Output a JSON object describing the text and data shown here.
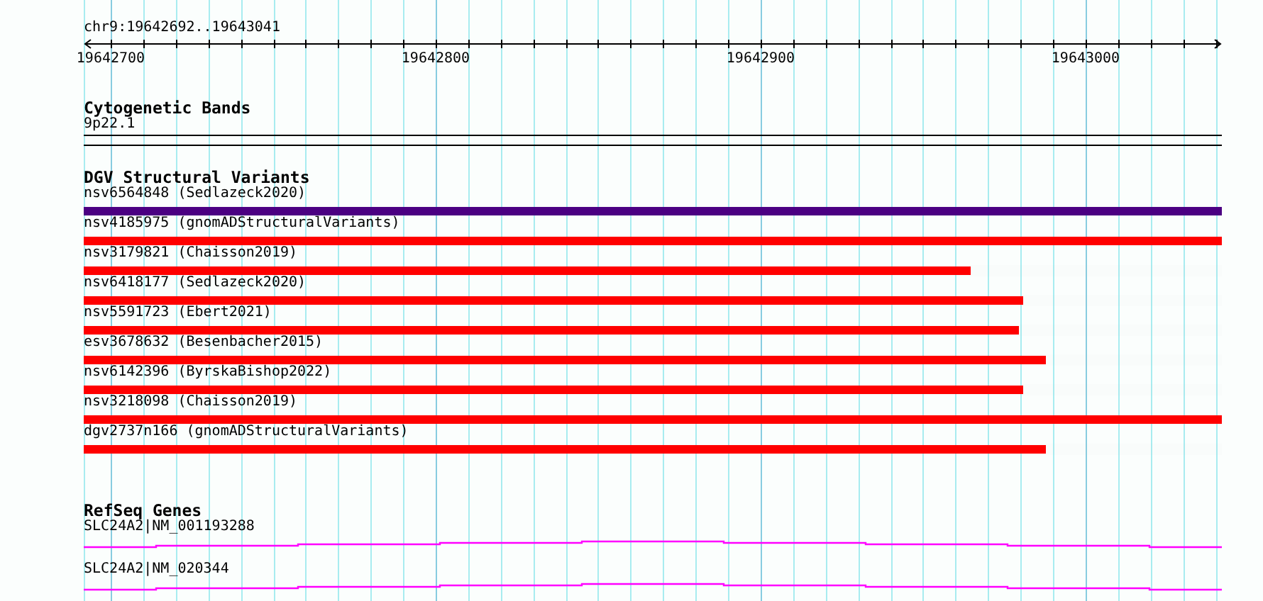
{
  "location": "chr9:19642692..19643041",
  "axis": {
    "ticks": [
      "19642700",
      "19642800",
      "19642900",
      "19643000"
    ]
  },
  "tracks": [
    {
      "kind": "bands",
      "title": "Cytogenetic Bands",
      "features": [
        {
          "label": "9p22.1"
        }
      ]
    },
    {
      "kind": "variants",
      "title": "DGV Structural Variants",
      "features": [
        {
          "label": "nsv6564848 (Sedlazeck2020)",
          "level": 1,
          "color": "#4b0082"
        },
        {
          "label": "nsv4185975 (gnomADStructuralVariants)",
          "level": 1,
          "color": "#ff0000"
        },
        {
          "label": "nsv3179821 (Chaisson2019)",
          "level": 0.779,
          "color": "#ff0000"
        },
        {
          "label": "nsv6418177 (Sedlazeck2020)",
          "level": 0.825,
          "color": "#ff0000"
        },
        {
          "label": "nsv5591723 (Ebert2021)",
          "level": 0.822,
          "color": "#ff0000"
        },
        {
          "label": "esv3678632 (Besenbacher2015)",
          "level": 0.845,
          "color": "#ff0000"
        },
        {
          "label": "nsv6142396 (ByrskaBishop2022)",
          "level": 0.825,
          "color": "#ff0000"
        },
        {
          "label": "nsv3218098 (Chaisson2019)",
          "level": 1,
          "color": "#ff0000"
        },
        {
          "label": "dgv2737n166 (gnomADStructuralVariants)",
          "level": 0.845,
          "color": "#ff0000"
        }
      ]
    },
    {
      "kind": "genes",
      "title": "RefSeq Genes",
      "features": [
        {
          "label": "SLC24A2|NM_001193288"
        },
        {
          "label": "SLC24A2|NM_020344"
        }
      ]
    }
  ]
}
